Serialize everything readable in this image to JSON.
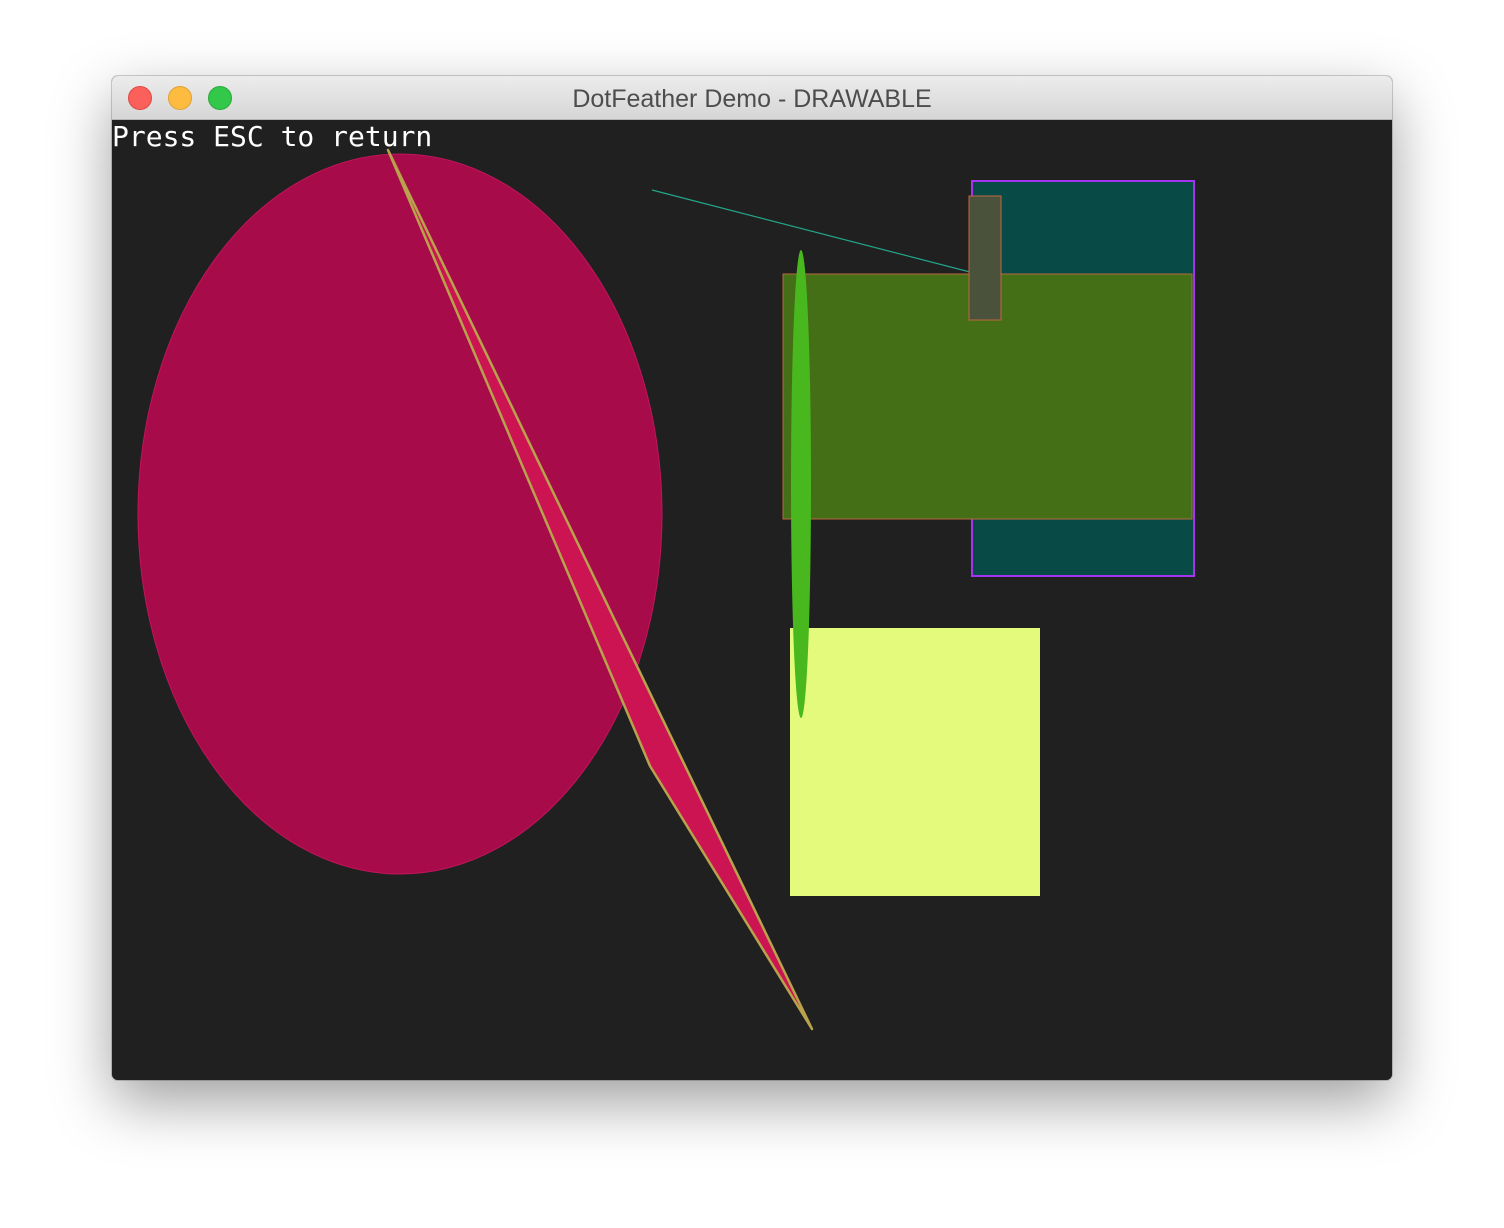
{
  "window": {
    "title": "DotFeather Demo - DRAWABLE"
  },
  "traffic_lights": {
    "close": "close-button",
    "minimize": "minimize-button",
    "zoom": "zoom-button",
    "close_color": "#fc605b",
    "minimize_color": "#fdbc40",
    "zoom_color": "#34c84a"
  },
  "canvas": {
    "background": "#202020",
    "hint": "Press ESC to return"
  },
  "colors": {
    "ellipse_fill": "#a80b49",
    "triangle_fill": "#cc1452",
    "triangle_stroke": "#b8a34c",
    "line": "#22a58a",
    "teal_rect_fill": "#084a46",
    "teal_rect_stroke": "#a335f0",
    "green_rect_fill": "#446f17",
    "green_rect_stroke": "#b86a3e",
    "small_rect_fill": "#4a523c",
    "small_rect_stroke": "#c0683f",
    "green_ellipse_fill": "#48b81e",
    "yellow_rect_fill": "#e3fa7d"
  }
}
